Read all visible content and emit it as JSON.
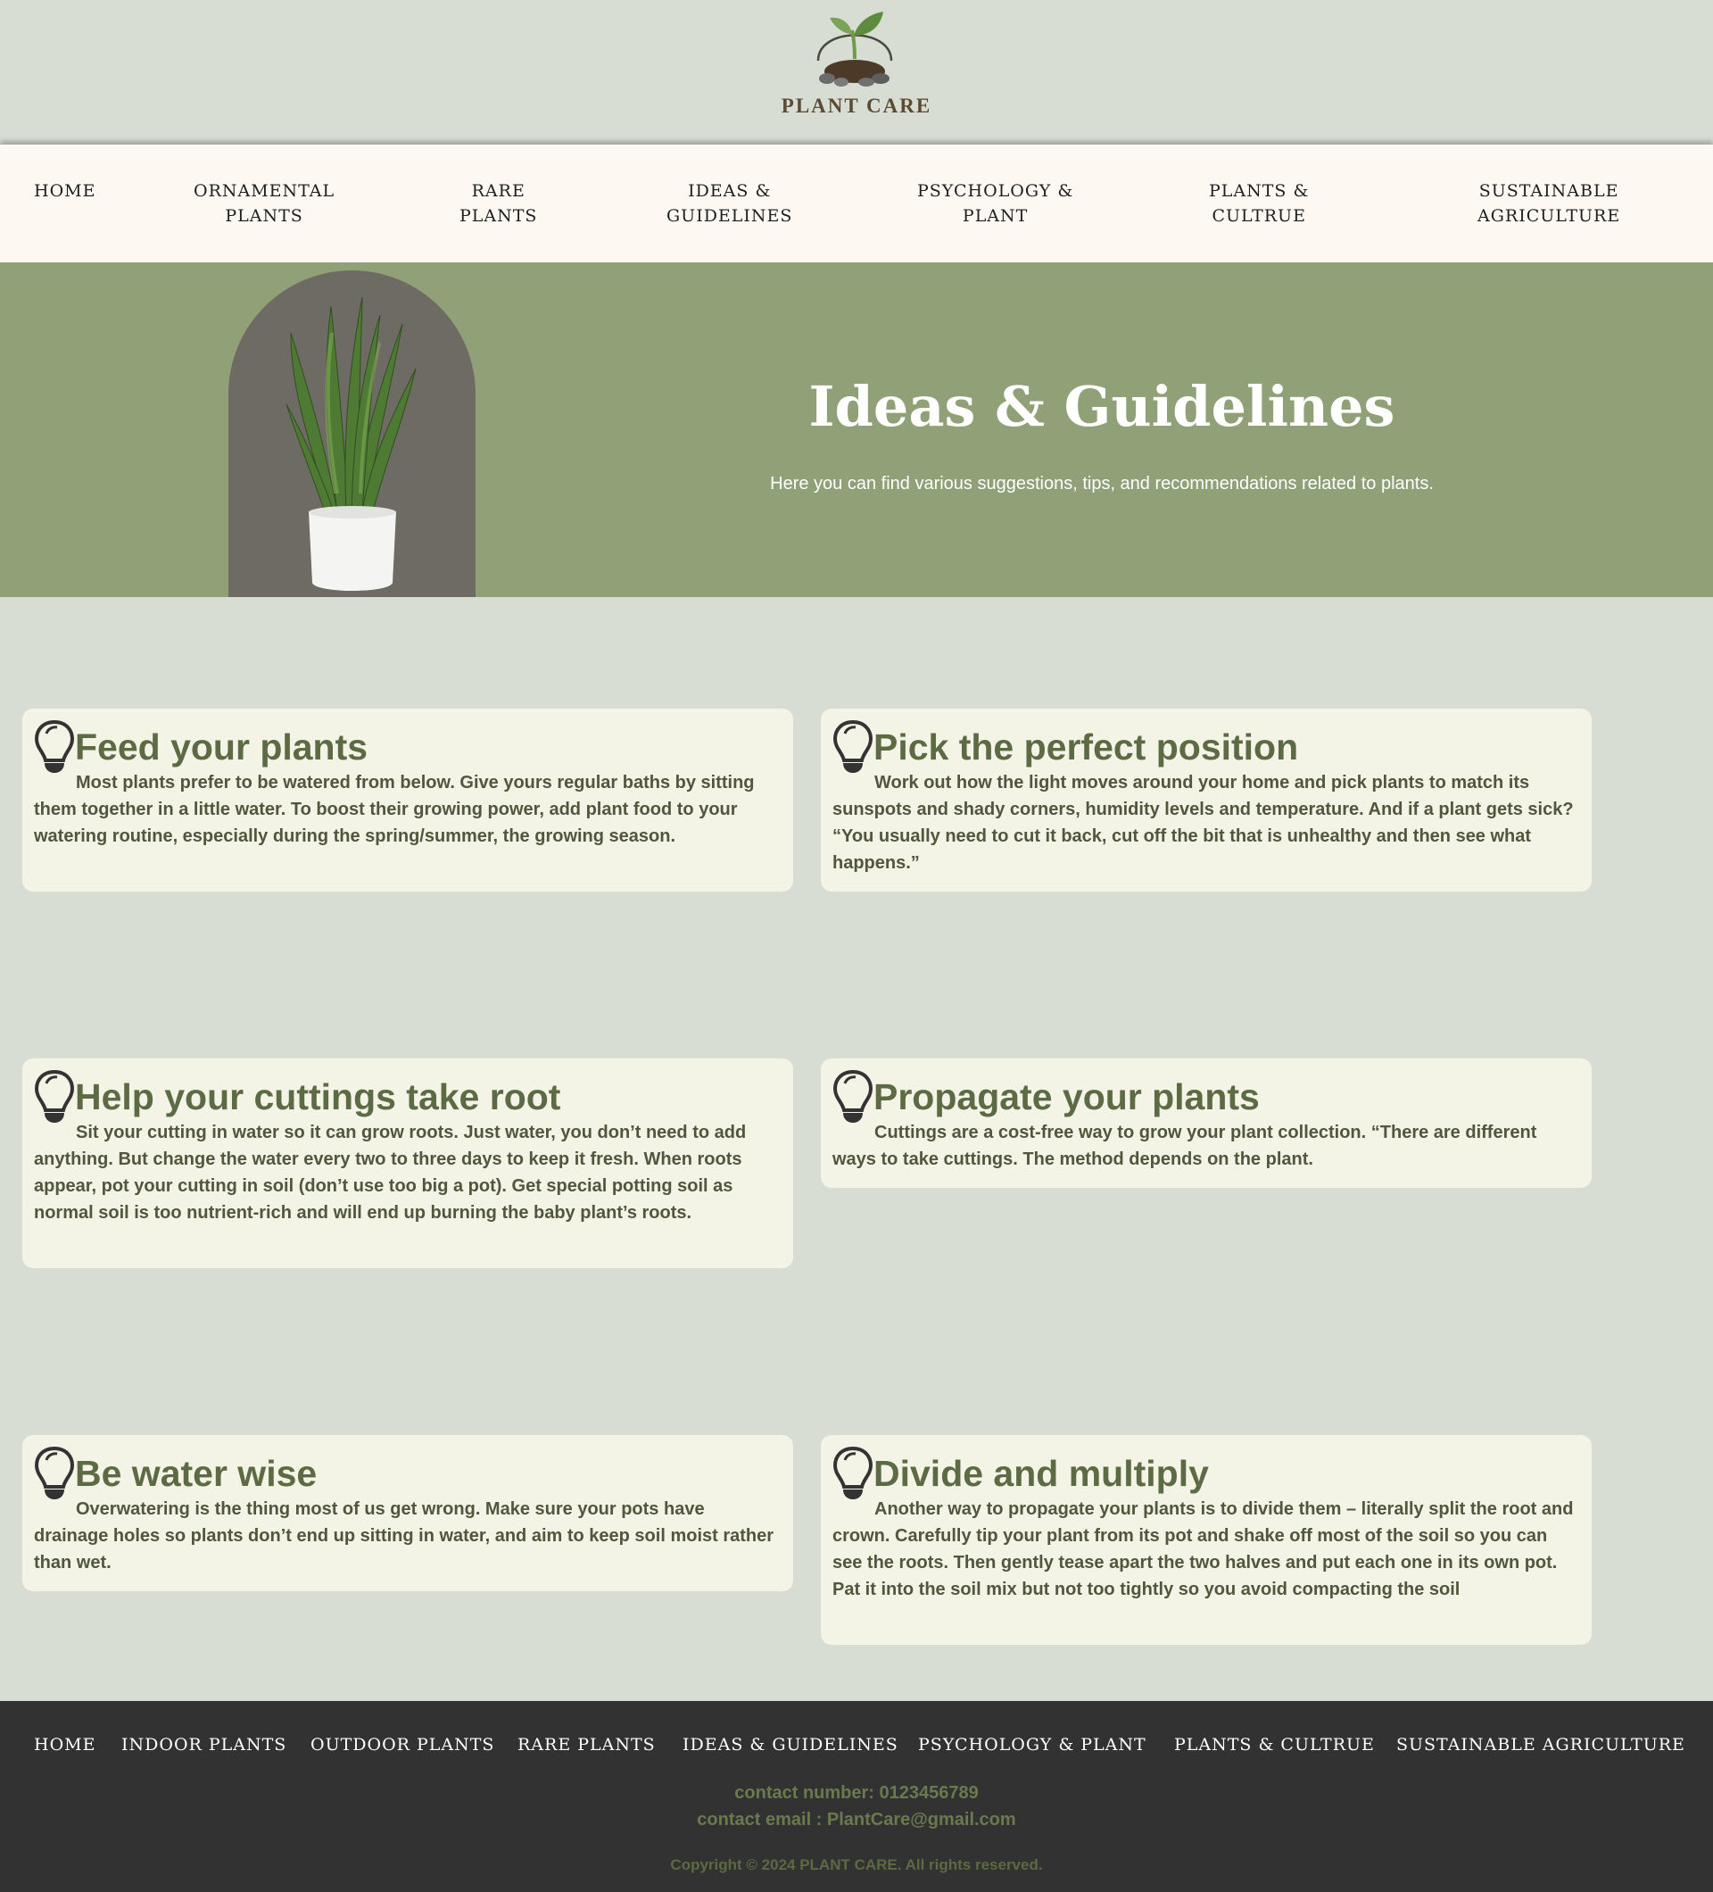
{
  "brand": {
    "name": "PLANT CARE"
  },
  "nav": {
    "items": [
      {
        "line1": "HOME",
        "line2": ""
      },
      {
        "line1": "ORNAMENTAL",
        "line2": "PLANTS"
      },
      {
        "line1": "RARE",
        "line2": "PLANTS"
      },
      {
        "line1": "IDEAS &",
        "line2": "GUIDELINES"
      },
      {
        "line1": "PSYCHOLOGY &",
        "line2": "PLANT"
      },
      {
        "line1": "PLANTS &",
        "line2": "CULTRUE"
      },
      {
        "line1": "SUSTAINABLE",
        "line2": "AGRICULTURE"
      }
    ]
  },
  "hero": {
    "title": "Ideas & Guidelines",
    "subtitle": "Here you can find various suggestions, tips, and recommendations related to plants."
  },
  "tips": [
    {
      "title": "Feed your plants",
      "text": "Most plants prefer to be watered from below. Give yours regular baths by sitting them together in a little water. To boost their growing power, add plant food to your watering routine, especially during the spring/summer, the growing season."
    },
    {
      "title": "Pick the perfect position",
      "text": "Work out how the light moves around your home and pick plants to match its sunspots and shady corners, humidity levels and temperature. And if a plant gets sick? “You usually need to cut it back, cut off the bit that is unhealthy and then see what happens.”"
    },
    {
      "title": "Help your cuttings take root",
      "text": "Sit your cutting in water so it can grow roots. Just water, you don’t need to add anything. But change the water every two to three days to keep it fresh. When roots appear, pot your cutting in soil (don’t use too big a pot). Get special potting soil as normal soil is too nutrient-rich and will end up burning the baby plant’s roots."
    },
    {
      "title": "Propagate your plants",
      "text": "Cuttings are a cost-free way to grow your plant collection. “There are different ways to take cuttings. The method depends on the plant."
    },
    {
      "title": "Be water wise",
      "text": "Overwatering is the thing most of us get wrong. Make sure your pots have drainage holes so plants don’t end up sitting in water, and aim to keep soil moist rather than wet."
    },
    {
      "title": "Divide and multiply",
      "text": "Another way to propagate your plants is to divide them – literally split the root and crown. Carefully tip your plant from its pot and shake off most of the soil so you can see the roots. Then gently tease apart the two halves and put each one in its own pot. Pat it into the soil mix but not too tightly so you avoid compacting the soil"
    }
  ],
  "footer": {
    "links": [
      "HOME",
      "INDOOR PLANTS",
      "OUTDOOR PLANTS",
      "RARE PLANTS",
      "IDEAS & GUIDELINES",
      "PSYCHOLOGY & PLANT",
      "PLANTS & CULTRUE",
      "SUSTAINABLE AGRICULTURE"
    ],
    "contact_number": "contact number: 0123456789",
    "contact_email": "contact email : PlantCare@gmail.com",
    "copyright": "Copyright © 2024 PLANT CARE. All rights reserved."
  },
  "colors": {
    "page_bg": "#d8ddd3",
    "nav_bg": "#fdf8f2",
    "hero_bg": "#90a077",
    "card_bg": "#f3f3e6",
    "title_green": "#5c6b44",
    "footer_bg": "#323232"
  }
}
